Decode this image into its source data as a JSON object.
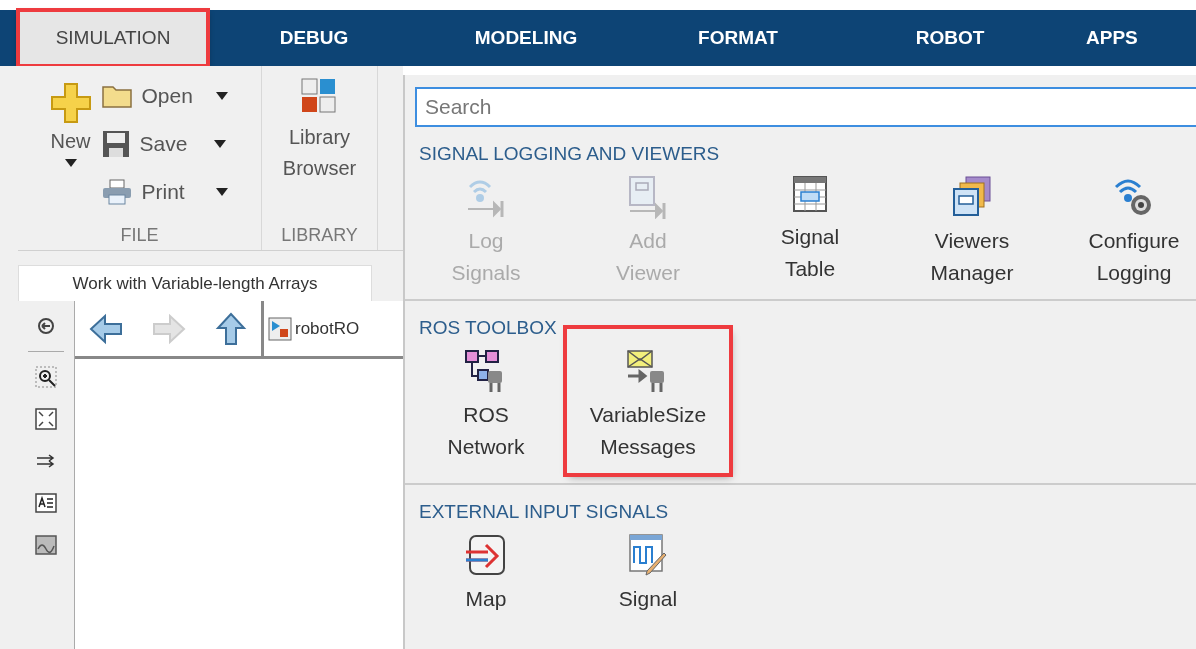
{
  "tabs": [
    {
      "label": "SIMULATION",
      "selected": true,
      "highlighted": true
    },
    {
      "label": "DEBUG",
      "selected": false,
      "highlighted": false
    },
    {
      "label": "MODELING",
      "selected": false,
      "highlighted": false
    },
    {
      "label": "FORMAT",
      "selected": false,
      "highlighted": false
    },
    {
      "label": "ROBOT",
      "selected": false,
      "highlighted": false
    },
    {
      "label": "APPS",
      "selected": false,
      "highlighted": false
    }
  ],
  "file_section": {
    "title": "FILE",
    "new_label": "New",
    "actions": [
      "Open",
      "Save",
      "Print"
    ]
  },
  "library_section": {
    "title": "LIBRARY",
    "button_label": [
      "Library",
      "Browser"
    ]
  },
  "document_tab": {
    "label": "Work with Variable-length Arrays"
  },
  "breadcrumb": "robotRO",
  "gallery": {
    "search": {
      "placeholder": "Search"
    },
    "sections": [
      {
        "title": "SIGNAL LOGGING AND VIEWERS",
        "items": [
          {
            "label": [
              "Log",
              "Signals"
            ],
            "disabled": true,
            "highlighted": false
          },
          {
            "label": [
              "Add",
              "Viewer"
            ],
            "disabled": true,
            "highlighted": false
          },
          {
            "label": [
              "Signal",
              "Table"
            ],
            "disabled": false,
            "highlighted": false
          },
          {
            "label": [
              "Viewers",
              "Manager"
            ],
            "disabled": false,
            "highlighted": false
          },
          {
            "label": [
              "Configure",
              "Logging"
            ],
            "disabled": false,
            "highlighted": false
          }
        ]
      },
      {
        "title": "ROS TOOLBOX",
        "items": [
          {
            "label": [
              "ROS",
              "Network"
            ],
            "disabled": false,
            "highlighted": false
          },
          {
            "label": [
              "VariableSize",
              "Messages"
            ],
            "disabled": false,
            "highlighted": true
          }
        ]
      },
      {
        "title": "EXTERNAL INPUT SIGNALS",
        "items": [
          {
            "label": [
              "Map"
            ],
            "disabled": false,
            "highlighted": false
          },
          {
            "label": [
              "Signal"
            ],
            "disabled": false,
            "highlighted": false
          }
        ]
      }
    ]
  }
}
